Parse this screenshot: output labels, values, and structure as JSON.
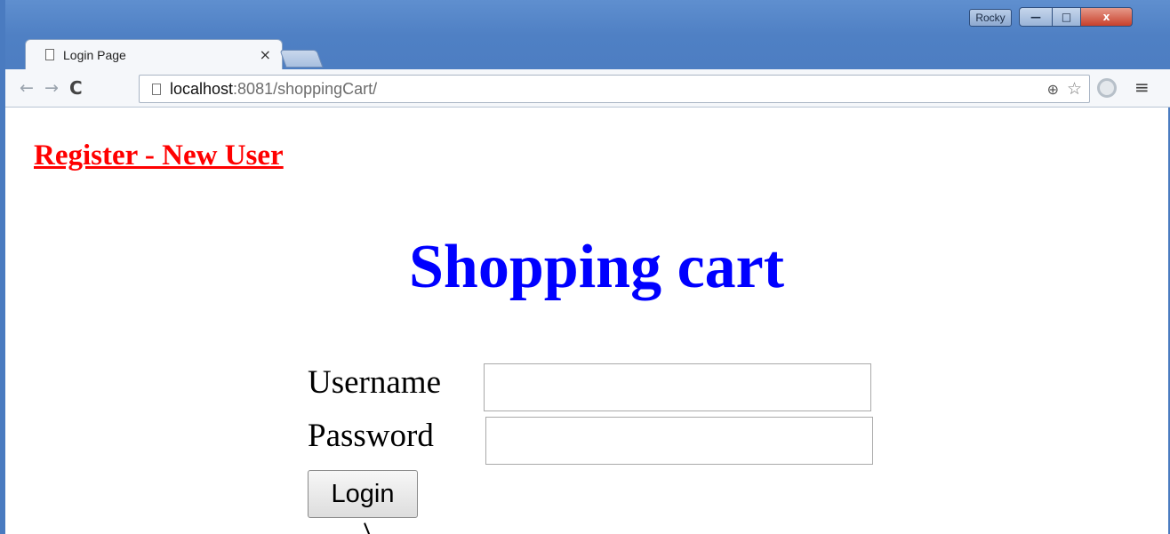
{
  "browser": {
    "user_badge": "Rocky",
    "window_buttons": {
      "minimize": "—",
      "maximize": "□",
      "close": "x"
    },
    "tab": {
      "title": "Login Page",
      "close_glyph": "×"
    },
    "nav": {
      "back_glyph": "←",
      "forward_glyph": "→",
      "reload_glyph": "C"
    },
    "url": {
      "host": "localhost",
      "rest": ":8081/shoppingCart/"
    },
    "icons": [
      "page-icon",
      "zoom-icon",
      "star-icon",
      "extension-icon",
      "menu-icon"
    ],
    "menu_glyph": "≡",
    "zoom_glyph": "⊕",
    "star_glyph": "☆"
  },
  "page": {
    "register_link": "Register - New User",
    "heading": "Shopping cart",
    "form": {
      "username_label": "Username",
      "password_label": "Password",
      "username_value": "",
      "password_value": "",
      "login_button": "Login"
    }
  },
  "colors": {
    "link": "#ff0000",
    "heading": "#0000ff",
    "window_frame": "#4a7bc0"
  }
}
